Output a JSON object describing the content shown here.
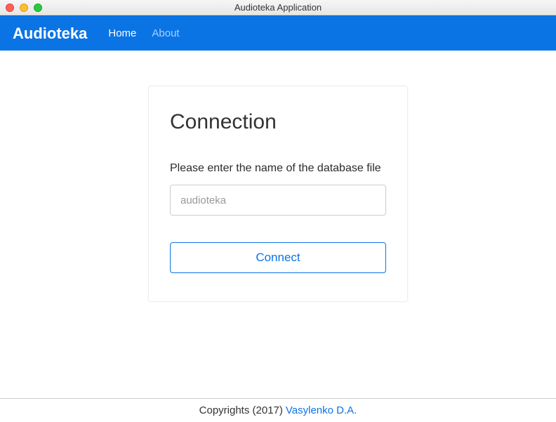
{
  "window": {
    "title": "Audioteka Application"
  },
  "navbar": {
    "brand": "Audioteka",
    "links": {
      "home": "Home",
      "about": "About"
    }
  },
  "card": {
    "heading": "Connection",
    "prompt": "Please enter the name of the database file",
    "input_placeholder": "audioteka",
    "connect_label": "Connect"
  },
  "footer": {
    "copyright": "Copyrights (2017)",
    "author": "Vasylenko D.A."
  }
}
